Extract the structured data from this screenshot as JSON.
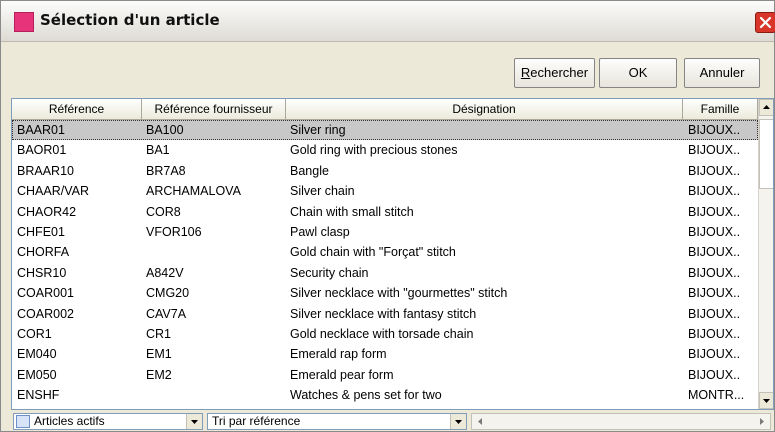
{
  "window": {
    "title": "Sélection d'un article",
    "icons": {
      "app": "app-icon",
      "close": "close-icon"
    },
    "accent": "#e6337a"
  },
  "toolbar": {
    "search_label_first": "R",
    "search_label_rest": "echercher",
    "ok_label": "OK",
    "cancel_label": "Annuler"
  },
  "grid": {
    "columns": [
      "Référence",
      "Référence fournisseur",
      "Désignation",
      "Famille"
    ],
    "selected_row": 0,
    "rows": [
      {
        "ref": "BAAR01",
        "supplier": "BA100",
        "designation": "Silver ring",
        "family": "BIJOUX.."
      },
      {
        "ref": "BAOR01",
        "supplier": "BA1",
        "designation": "Gold ring with precious stones",
        "family": "BIJOUX.."
      },
      {
        "ref": "BRAAR10",
        "supplier": "BR7A8",
        "designation": "Bangle",
        "family": "BIJOUX.."
      },
      {
        "ref": "CHAAR/VAR",
        "supplier": "ARCHAMALOVA",
        "designation": "Silver chain",
        "family": "BIJOUX.."
      },
      {
        "ref": "CHAOR42",
        "supplier": "COR8",
        "designation": "Chain with small stitch",
        "family": "BIJOUX.."
      },
      {
        "ref": "CHFE01",
        "supplier": "VFOR106",
        "designation": "Pawl clasp",
        "family": "BIJOUX.."
      },
      {
        "ref": "CHORFA",
        "supplier": "",
        "designation": "Gold chain with \"Forçat\" stitch",
        "family": "BIJOUX.."
      },
      {
        "ref": "CHSR10",
        "supplier": "A842V",
        "designation": "Security chain",
        "family": "BIJOUX.."
      },
      {
        "ref": "COAR001",
        "supplier": "CMG20",
        "designation": "Silver necklace with \"gourmettes\" stitch",
        "family": "BIJOUX.."
      },
      {
        "ref": "COAR002",
        "supplier": "CAV7A",
        "designation": "Silver necklace with fantasy stitch",
        "family": "BIJOUX.."
      },
      {
        "ref": "COR1",
        "supplier": "CR1",
        "designation": "Gold necklace with torsade chain",
        "family": "BIJOUX.."
      },
      {
        "ref": "EM040",
        "supplier": "EM1",
        "designation": "Emerald rap form",
        "family": "BIJOUX.."
      },
      {
        "ref": "EM050",
        "supplier": "EM2",
        "designation": "Emerald pear form",
        "family": "BIJOUX.."
      },
      {
        "ref": "ENSHF",
        "supplier": "",
        "designation": "Watches & pens set for two",
        "family": "MONTR..."
      }
    ]
  },
  "statusbar": {
    "filter_value": "Articles actifs",
    "sort_value": "Tri par référence",
    "icons": {
      "filter": "filter-icon",
      "dropdown": "chevron-down-icon"
    }
  }
}
